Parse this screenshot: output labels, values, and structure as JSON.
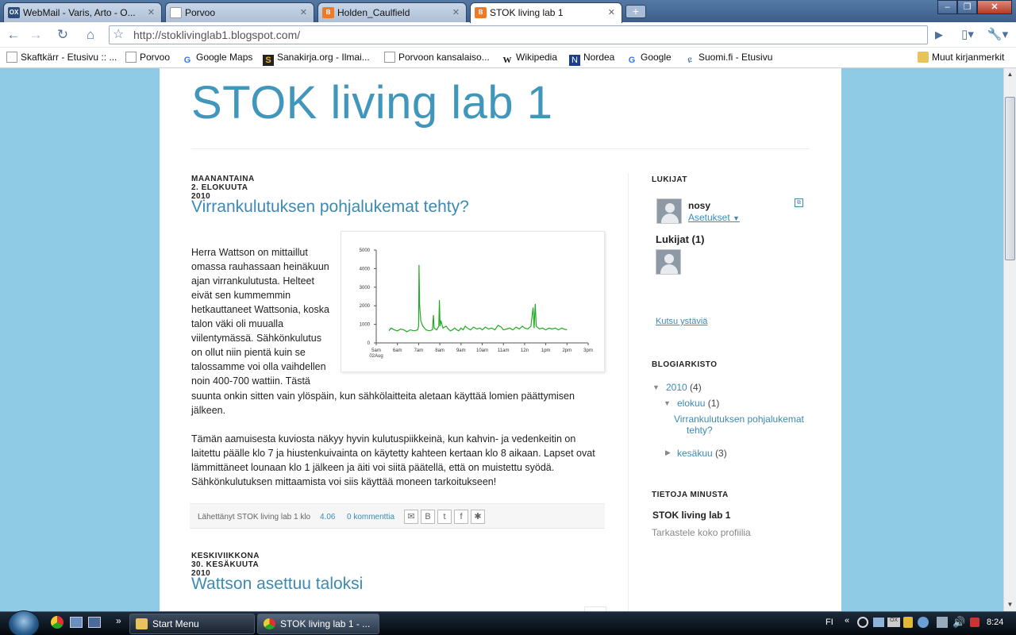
{
  "browser": {
    "tabs": [
      {
        "icon": "ox-icon",
        "icon_text": "OX",
        "title": "WebMail - Varis, Arto - O..."
      },
      {
        "icon": "page-icon",
        "icon_text": "",
        "title": "Porvoo"
      },
      {
        "icon": "blogger-icon",
        "icon_text": "B",
        "title": "Holden_Caulfield"
      },
      {
        "icon": "blogger-icon",
        "icon_text": "B",
        "title": "STOK living lab 1"
      }
    ],
    "url": "http://stoklivinglab1.blogspot.com/",
    "bookmarks": [
      {
        "icon": "page-icon",
        "label": "Skaftkärr - Etusivu :: ..."
      },
      {
        "icon": "page-icon",
        "label": "Porvoo"
      },
      {
        "icon": "google-icon",
        "label": "Google Maps"
      },
      {
        "icon": "sanakirja-icon",
        "label": "Sanakirja.org - Ilmai..."
      },
      {
        "icon": "page-icon",
        "label": "Porvoon kansalaiso..."
      },
      {
        "icon": "wikipedia-icon",
        "label": "Wikipedia"
      },
      {
        "icon": "nordea-icon",
        "label": "Nordea"
      },
      {
        "icon": "google-icon",
        "label": "Google"
      },
      {
        "icon": "suomifi-icon",
        "label": "Suomi.fi - Etusivu"
      }
    ],
    "other_bookmarks": "Muut kirjanmerkit"
  },
  "blog": {
    "title": "STOK living lab 1",
    "posts": [
      {
        "date": "MAANANTAINA 2. ELOKUUTA 2010",
        "title": "Virrankulutuksen pohjalukemat tehty?",
        "para1a": "Herra Wattson on mittaillut omassa rauhassaan heinäkuun ajan virrankulutusta. Helteet eivät sen kummemmin hetkauttaneet Wattsonia, koska talon väki oli muualla viilentymässä. Sähkönkulutus on ollut niin pientä kuin se talossamme voi olla vaihdellen noin 400-700 wattiin. Tästä",
        "para1b": "suunta onkin sitten vain ylöspäin, kun sähkölaitteita aletaan käyttää lomien päättymisen jälkeen.",
        "para2": "Tämän aamuisesta kuviosta näkyy hyvin kulutuspiikkeinä, kun kahvin- ja vedenkeitin on laitettu päälle klo 7 ja hiustenkuivainta on käytetty kahteen kertaan klo 8 aikaan. Lapset ovat lämmittäneet lounaan klo 1 jälkeen ja äiti voi siitä päätellä, että on muistettu syödä. Sähkönkulutuksen mittaamista voi siis käyttää moneen tarkoitukseen!",
        "footer_text": "Lähettänyt STOK living lab 1 klo",
        "footer_time": "4.06",
        "footer_comments": "0 kommenttia"
      },
      {
        "date": "KESKIVIIKKONA 30. KESÄKUUTA 2010",
        "title": "Wattson asettuu taloksi"
      }
    ]
  },
  "sidebar": {
    "followers_heading": "LUKIJAT",
    "user_name": "nosy",
    "settings_link": "Asetukset",
    "followers_count": "Lukijat (1)",
    "invite_link": "Kutsu ystäviä",
    "archive_heading": "BLOGIARKISTO",
    "archive": {
      "year": "2010",
      "year_count": "(4)",
      "month1": "elokuu",
      "month1_count": "(1)",
      "month1_post": "Virrankulutuksen pohjalukemat tehty?",
      "month2": "kesäkuu",
      "month2_count": "(3)"
    },
    "about_heading": "TIETOJA MINUSTA",
    "about_name": "STOK living lab 1",
    "profile_link": "Tarkastele koko profiilia"
  },
  "taskbar": {
    "start_menu": "Start Menu",
    "chrome_window": "STOK living lab 1 - ...",
    "language": "FI",
    "clock": "8:24"
  },
  "chart_data": {
    "type": "line",
    "x_ticks": [
      "5am\n02Aug",
      "6am",
      "7am",
      "8am",
      "9am",
      "10am",
      "11am",
      "12n",
      "1pm",
      "2pm",
      "3pm"
    ],
    "y_ticks": [
      0,
      1000,
      2000,
      3000,
      4000,
      5000
    ],
    "ylim": [
      0,
      5000
    ],
    "xlim": [
      5.0,
      15.0
    ],
    "series": [
      {
        "color": "#22aa22",
        "points": [
          [
            5.6,
            650
          ],
          [
            5.7,
            800
          ],
          [
            5.85,
            700
          ],
          [
            6.0,
            650
          ],
          [
            6.15,
            750
          ],
          [
            6.3,
            700
          ],
          [
            6.45,
            600
          ],
          [
            6.6,
            700
          ],
          [
            6.8,
            650
          ],
          [
            6.95,
            700
          ],
          [
            7.0,
            900
          ],
          [
            7.02,
            4200
          ],
          [
            7.05,
            2000
          ],
          [
            7.1,
            1200
          ],
          [
            7.2,
            900
          ],
          [
            7.35,
            700
          ],
          [
            7.5,
            650
          ],
          [
            7.65,
            700
          ],
          [
            7.7,
            1500
          ],
          [
            7.73,
            800
          ],
          [
            7.85,
            700
          ],
          [
            7.95,
            900
          ],
          [
            7.98,
            2300
          ],
          [
            8.01,
            900
          ],
          [
            8.05,
            1200
          ],
          [
            8.15,
            800
          ],
          [
            8.3,
            900
          ],
          [
            8.4,
            750
          ],
          [
            8.5,
            650
          ],
          [
            8.6,
            700
          ],
          [
            8.7,
            800
          ],
          [
            8.8,
            700
          ],
          [
            8.9,
            650
          ],
          [
            9.0,
            800
          ],
          [
            9.1,
            700
          ],
          [
            9.2,
            900
          ],
          [
            9.3,
            800
          ],
          [
            9.45,
            700
          ],
          [
            9.6,
            850
          ],
          [
            9.75,
            750
          ],
          [
            9.9,
            800
          ],
          [
            10.0,
            700
          ],
          [
            10.15,
            850
          ],
          [
            10.3,
            750
          ],
          [
            10.45,
            800
          ],
          [
            10.6,
            700
          ],
          [
            10.75,
            950
          ],
          [
            10.9,
            850
          ],
          [
            11.0,
            700
          ],
          [
            11.15,
            750
          ],
          [
            11.3,
            800
          ],
          [
            11.45,
            700
          ],
          [
            11.6,
            850
          ],
          [
            11.75,
            750
          ],
          [
            11.9,
            900
          ],
          [
            12.0,
            800
          ],
          [
            12.15,
            750
          ],
          [
            12.3,
            900
          ],
          [
            12.4,
            1900
          ],
          [
            12.45,
            800
          ],
          [
            12.5,
            2100
          ],
          [
            12.55,
            900
          ],
          [
            12.7,
            750
          ],
          [
            12.85,
            800
          ],
          [
            13.0,
            700
          ],
          [
            13.15,
            800
          ],
          [
            13.3,
            750
          ],
          [
            13.45,
            800
          ],
          [
            13.6,
            700
          ],
          [
            13.75,
            800
          ],
          [
            13.85,
            750
          ],
          [
            14.0,
            700
          ]
        ]
      }
    ]
  },
  "colors": {
    "accent": "#4196bb",
    "link": "#3c8ab3",
    "background": "#8fcbe4",
    "chart_line": "#22aa22"
  }
}
